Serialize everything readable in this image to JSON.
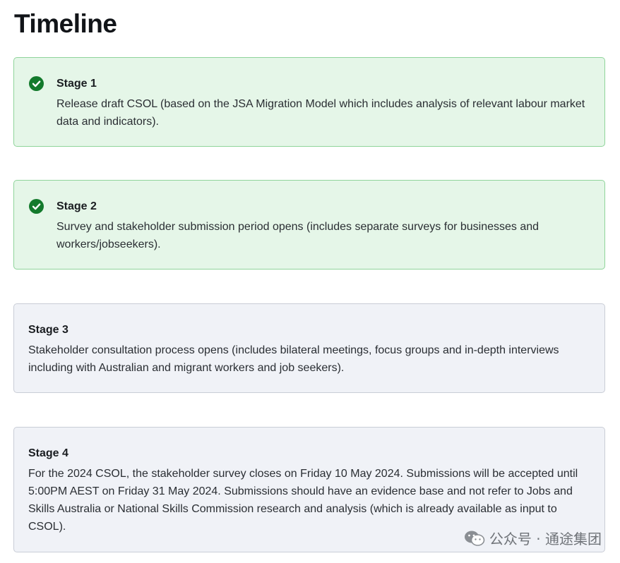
{
  "page": {
    "title": "Timeline"
  },
  "stages": [
    {
      "label": "Stage 1",
      "status": "complete",
      "description": "Release draft CSOL (based on the JSA Migration Model which includes analysis of relevant labour market data and indicators)."
    },
    {
      "label": "Stage 2",
      "status": "complete",
      "description": "Survey and stakeholder submission period opens (includes separate surveys for businesses and workers/jobseekers)."
    },
    {
      "label": "Stage 3",
      "status": "pending",
      "description": "Stakeholder consultation process opens (includes bilateral meetings, focus groups and in-depth interviews including with Australian and migrant workers and job seekers)."
    },
    {
      "label": "Stage 4",
      "status": "pending",
      "description": "For the 2024 CSOL, the stakeholder survey closes on Friday 10 May 2024. Submissions will be accepted until 5:00PM AEST on Friday 31 May 2024. Submissions should have an evidence base and not refer to Jobs and Skills Australia or National Skills Commission research and analysis (which is already available as input to CSOL)."
    }
  ],
  "watermark": {
    "text": "公众号 · 通途集团",
    "icon": "wechat-icon"
  },
  "colors": {
    "complete_background": "#e5f6e8",
    "complete_border": "#8fd49a",
    "check_icon": "#137a2c",
    "pending_background": "#f0f2f7",
    "pending_border": "#c9cdd6"
  }
}
